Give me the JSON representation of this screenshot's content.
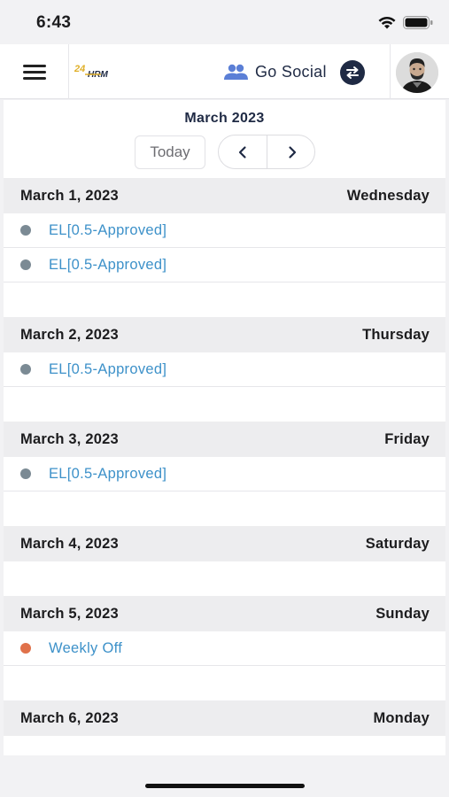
{
  "status_bar": {
    "time": "6:43"
  },
  "header": {
    "go_social_label": "Go Social",
    "logo_text": "HRM",
    "accent_color": "#1f2a44",
    "logo_color": "#e0b02a"
  },
  "calendar": {
    "month_title": "March 2023",
    "today_label": "Today"
  },
  "days": [
    {
      "date": "March 1, 2023",
      "weekday": "Wednesday",
      "events": [
        {
          "label": "EL[0.5-Approved]",
          "color": "#7b8a94"
        },
        {
          "label": "EL[0.5-Approved]",
          "color": "#7b8a94"
        }
      ]
    },
    {
      "date": "March 2, 2023",
      "weekday": "Thursday",
      "events": [
        {
          "label": "EL[0.5-Approved]",
          "color": "#7b8a94"
        }
      ]
    },
    {
      "date": "March 3, 2023",
      "weekday": "Friday",
      "events": [
        {
          "label": "EL[0.5-Approved]",
          "color": "#7b8a94"
        }
      ]
    },
    {
      "date": "March 4, 2023",
      "weekday": "Saturday",
      "events": []
    },
    {
      "date": "March 5, 2023",
      "weekday": "Sunday",
      "events": [
        {
          "label": "Weekly Off",
          "color": "#e0714a"
        }
      ]
    },
    {
      "date": "March 6, 2023",
      "weekday": "Monday",
      "events": []
    }
  ]
}
